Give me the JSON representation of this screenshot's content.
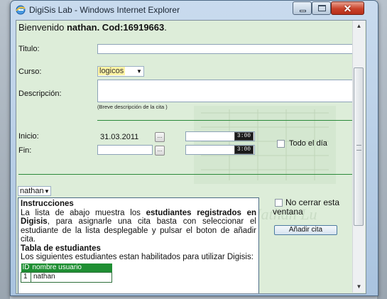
{
  "window": {
    "title": "DigiSis Lab - Windows Internet Explorer"
  },
  "header": {
    "welcome_prefix": "Bienvenido ",
    "user": "nathan",
    "cod": ". Cod:16919663",
    "suffix": "."
  },
  "form": {
    "titulo_label": "Titulo:",
    "titulo_value": "",
    "curso_label": "Curso:",
    "curso_value": "logicos",
    "descripcion_label": "Descripción:",
    "descripcion_value": "",
    "descripcion_hint": "(Breve descripción de la cita )",
    "inicio_label": "Inicio:",
    "inicio_date": "31.03.2011",
    "inicio_time": "3:00",
    "fin_label": "Fin:",
    "fin_date": "",
    "fin_time": "3:00",
    "todo_dia_label": "Todo el día",
    "date_button_label": "..."
  },
  "student_select": {
    "value": "nathan"
  },
  "instructions": {
    "title": "Instrucciones",
    "p1_a": "La lista de abajo muestra los ",
    "p1_b": "estudiantes registrados en Digisis",
    "p1_c": ", para asignarle una cita basta con seleccionar el estudiante de la lista desplegable y pulsar el boton de añadir cita.",
    "table_title": "Tabla de estudiantes",
    "p2": "Los siguientes estudiantes estan habilitados para utilizar Digisis:",
    "columns": [
      "ID",
      "nombre usuario"
    ],
    "rows": [
      [
        "1",
        "nathan"
      ]
    ]
  },
  "right_panel": {
    "no_cerrar_label": "No cerrar esta ventana",
    "add_button": "Añadir cita"
  },
  "colors": {
    "accent_green": "#1f8f33",
    "highlight": "#fff4a4",
    "content_bg": "#ddedd9"
  },
  "icons": {
    "browser": "ie-icon",
    "minimize": "minimize-icon",
    "maximize": "maximize-icon",
    "close": "close-icon",
    "dropdown": "chevron-down-icon",
    "calendar": "calendar-button"
  }
}
